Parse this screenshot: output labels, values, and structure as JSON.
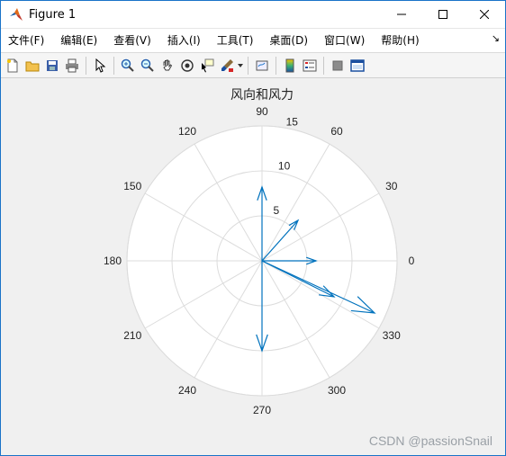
{
  "window": {
    "title": "Figure 1",
    "controls": {
      "minimize": "—",
      "maximize": "☐",
      "close": "✕"
    }
  },
  "menu": {
    "items": [
      "文件(F)",
      "编辑(E)",
      "查看(V)",
      "插入(I)",
      "工具(T)",
      "桌面(D)",
      "窗口(W)",
      "帮助(H)"
    ],
    "overflow_glyph": "↘"
  },
  "toolbar": {
    "buttons": [
      "new-figure-icon",
      "open-file-icon",
      "save-icon",
      "print-icon",
      "pointer-icon",
      "zoom-in-icon",
      "zoom-out-icon",
      "pan-hand-icon",
      "rotate-3d-icon",
      "data-cursor-icon",
      "brush-icon",
      "link-plot-icon",
      "colorbar-icon",
      "legend-icon",
      "hide-plot-tools-icon",
      "show-plot-tools-icon"
    ]
  },
  "chart_data": {
    "type": "compass",
    "title": "风向和风力",
    "radial_ticks": [
      5,
      10,
      15
    ],
    "rlim": [
      0,
      15
    ],
    "angle_ticks_deg": [
      0,
      30,
      60,
      90,
      120,
      150,
      180,
      210,
      240,
      270,
      300,
      330
    ],
    "angle_tick_labels": [
      "0",
      "30",
      "60",
      "90",
      "120",
      "150",
      "180",
      "210",
      "240",
      "270",
      "300",
      "330"
    ],
    "grid": true,
    "series_color": "#0072bd",
    "vectors": [
      {
        "u": 6,
        "v": 0
      },
      {
        "u": 4,
        "v": 4.5
      },
      {
        "u": 0,
        "v": 8.2
      },
      {
        "u": 0,
        "v": -10
      },
      {
        "u": 8,
        "v": -4
      },
      {
        "u": 12.5,
        "v": -5.8
      }
    ]
  },
  "watermark": "CSDN @passionSnail",
  "colors": {
    "axes_background": "#ffffff",
    "grid": "#dcdcdc",
    "figure_background": "#f0f0f0"
  }
}
